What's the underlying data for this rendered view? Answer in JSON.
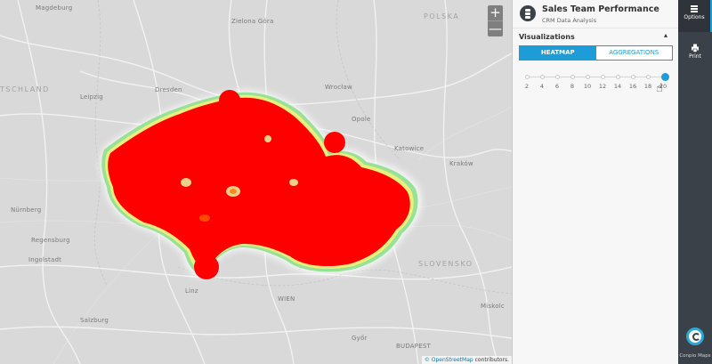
{
  "map": {
    "countries": [
      "POLSKA",
      "TSCHLAND",
      "SLOVENSKO"
    ],
    "places": [
      "Magdeburg",
      "Zielona Góra",
      "Wrocław",
      "Dresden",
      "Opole",
      "Katowice",
      "Kraków",
      "Nürnberg",
      "Regensburg",
      "Ingolstadt",
      "Linz",
      "WIEN",
      "Miskolc",
      "Győr",
      "BUDAPEST",
      "Salzburg",
      "Leipzig"
    ],
    "zoom_in": "+",
    "zoom_out": "—",
    "attribution_link": "© OpenStreetMap",
    "attribution_text": " contributors."
  },
  "colors": {
    "heat_core": "#ff0000",
    "heat_edge": "#7fe08a",
    "accent": "#1e9cd7",
    "rail_bg": "#3a4148"
  },
  "panel": {
    "title": "Sales Team Performance",
    "subtitle": "CRM Data Analysis",
    "icon": "database-icon",
    "section_title": "Visualizations",
    "section_caret": "▴",
    "tabs": [
      {
        "label": "HEATMAP",
        "active": true
      },
      {
        "label": "AGGREGATIONS",
        "active": false
      }
    ],
    "slider": {
      "ticks": [
        "2",
        "4",
        "6",
        "8",
        "10",
        "12",
        "14",
        "16",
        "18",
        "20"
      ],
      "value": 20
    }
  },
  "rail": {
    "options_label": "Options",
    "print_label": "Print",
    "logo_label": "Conpio Maps"
  }
}
